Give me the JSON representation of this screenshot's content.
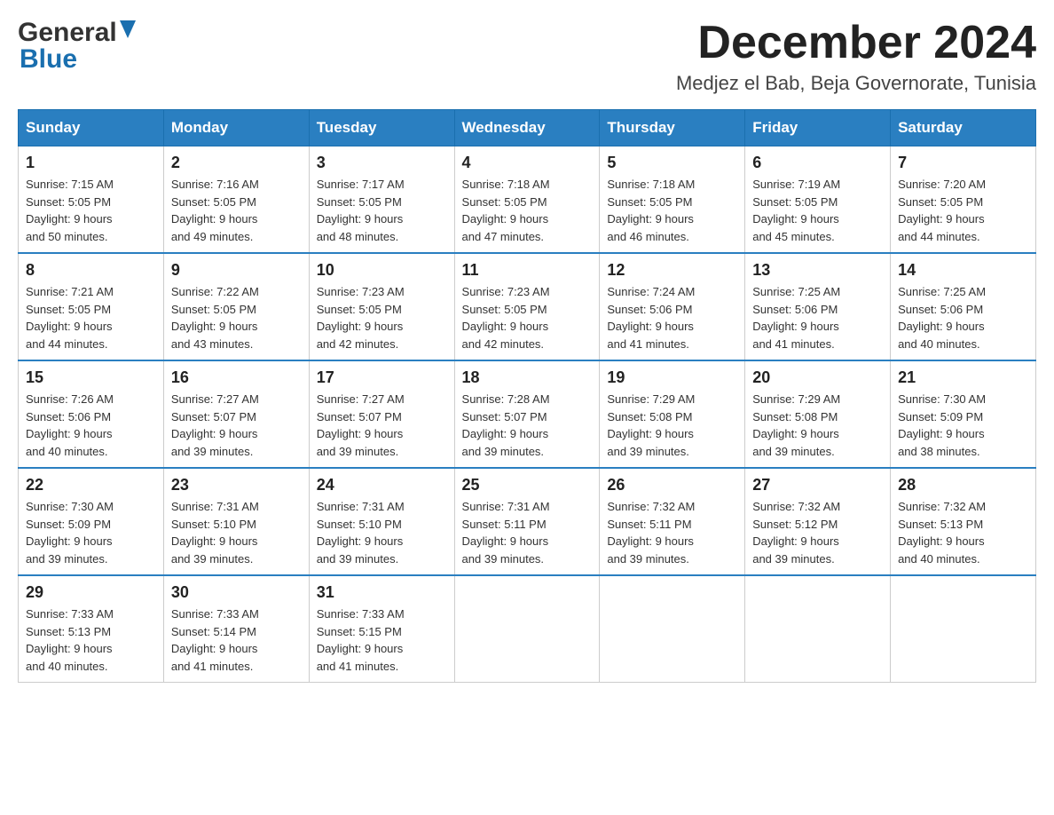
{
  "header": {
    "logo_general": "General",
    "logo_blue": "Blue",
    "month_title": "December 2024",
    "location": "Medjez el Bab, Beja Governorate, Tunisia"
  },
  "days_of_week": [
    "Sunday",
    "Monday",
    "Tuesday",
    "Wednesday",
    "Thursday",
    "Friday",
    "Saturday"
  ],
  "weeks": [
    [
      {
        "day": "1",
        "sunrise": "7:15 AM",
        "sunset": "5:05 PM",
        "daylight": "9 hours and 50 minutes."
      },
      {
        "day": "2",
        "sunrise": "7:16 AM",
        "sunset": "5:05 PM",
        "daylight": "9 hours and 49 minutes."
      },
      {
        "day": "3",
        "sunrise": "7:17 AM",
        "sunset": "5:05 PM",
        "daylight": "9 hours and 48 minutes."
      },
      {
        "day": "4",
        "sunrise": "7:18 AM",
        "sunset": "5:05 PM",
        "daylight": "9 hours and 47 minutes."
      },
      {
        "day": "5",
        "sunrise": "7:18 AM",
        "sunset": "5:05 PM",
        "daylight": "9 hours and 46 minutes."
      },
      {
        "day": "6",
        "sunrise": "7:19 AM",
        "sunset": "5:05 PM",
        "daylight": "9 hours and 45 minutes."
      },
      {
        "day": "7",
        "sunrise": "7:20 AM",
        "sunset": "5:05 PM",
        "daylight": "9 hours and 44 minutes."
      }
    ],
    [
      {
        "day": "8",
        "sunrise": "7:21 AM",
        "sunset": "5:05 PM",
        "daylight": "9 hours and 44 minutes."
      },
      {
        "day": "9",
        "sunrise": "7:22 AM",
        "sunset": "5:05 PM",
        "daylight": "9 hours and 43 minutes."
      },
      {
        "day": "10",
        "sunrise": "7:23 AM",
        "sunset": "5:05 PM",
        "daylight": "9 hours and 42 minutes."
      },
      {
        "day": "11",
        "sunrise": "7:23 AM",
        "sunset": "5:05 PM",
        "daylight": "9 hours and 42 minutes."
      },
      {
        "day": "12",
        "sunrise": "7:24 AM",
        "sunset": "5:06 PM",
        "daylight": "9 hours and 41 minutes."
      },
      {
        "day": "13",
        "sunrise": "7:25 AM",
        "sunset": "5:06 PM",
        "daylight": "9 hours and 41 minutes."
      },
      {
        "day": "14",
        "sunrise": "7:25 AM",
        "sunset": "5:06 PM",
        "daylight": "9 hours and 40 minutes."
      }
    ],
    [
      {
        "day": "15",
        "sunrise": "7:26 AM",
        "sunset": "5:06 PM",
        "daylight": "9 hours and 40 minutes."
      },
      {
        "day": "16",
        "sunrise": "7:27 AM",
        "sunset": "5:07 PM",
        "daylight": "9 hours and 39 minutes."
      },
      {
        "day": "17",
        "sunrise": "7:27 AM",
        "sunset": "5:07 PM",
        "daylight": "9 hours and 39 minutes."
      },
      {
        "day": "18",
        "sunrise": "7:28 AM",
        "sunset": "5:07 PM",
        "daylight": "9 hours and 39 minutes."
      },
      {
        "day": "19",
        "sunrise": "7:29 AM",
        "sunset": "5:08 PM",
        "daylight": "9 hours and 39 minutes."
      },
      {
        "day": "20",
        "sunrise": "7:29 AM",
        "sunset": "5:08 PM",
        "daylight": "9 hours and 39 minutes."
      },
      {
        "day": "21",
        "sunrise": "7:30 AM",
        "sunset": "5:09 PM",
        "daylight": "9 hours and 38 minutes."
      }
    ],
    [
      {
        "day": "22",
        "sunrise": "7:30 AM",
        "sunset": "5:09 PM",
        "daylight": "9 hours and 39 minutes."
      },
      {
        "day": "23",
        "sunrise": "7:31 AM",
        "sunset": "5:10 PM",
        "daylight": "9 hours and 39 minutes."
      },
      {
        "day": "24",
        "sunrise": "7:31 AM",
        "sunset": "5:10 PM",
        "daylight": "9 hours and 39 minutes."
      },
      {
        "day": "25",
        "sunrise": "7:31 AM",
        "sunset": "5:11 PM",
        "daylight": "9 hours and 39 minutes."
      },
      {
        "day": "26",
        "sunrise": "7:32 AM",
        "sunset": "5:11 PM",
        "daylight": "9 hours and 39 minutes."
      },
      {
        "day": "27",
        "sunrise": "7:32 AM",
        "sunset": "5:12 PM",
        "daylight": "9 hours and 39 minutes."
      },
      {
        "day": "28",
        "sunrise": "7:32 AM",
        "sunset": "5:13 PM",
        "daylight": "9 hours and 40 minutes."
      }
    ],
    [
      {
        "day": "29",
        "sunrise": "7:33 AM",
        "sunset": "5:13 PM",
        "daylight": "9 hours and 40 minutes."
      },
      {
        "day": "30",
        "sunrise": "7:33 AM",
        "sunset": "5:14 PM",
        "daylight": "9 hours and 41 minutes."
      },
      {
        "day": "31",
        "sunrise": "7:33 AM",
        "sunset": "5:15 PM",
        "daylight": "9 hours and 41 minutes."
      },
      null,
      null,
      null,
      null
    ]
  ],
  "labels": {
    "sunrise": "Sunrise:",
    "sunset": "Sunset:",
    "daylight": "Daylight:"
  }
}
